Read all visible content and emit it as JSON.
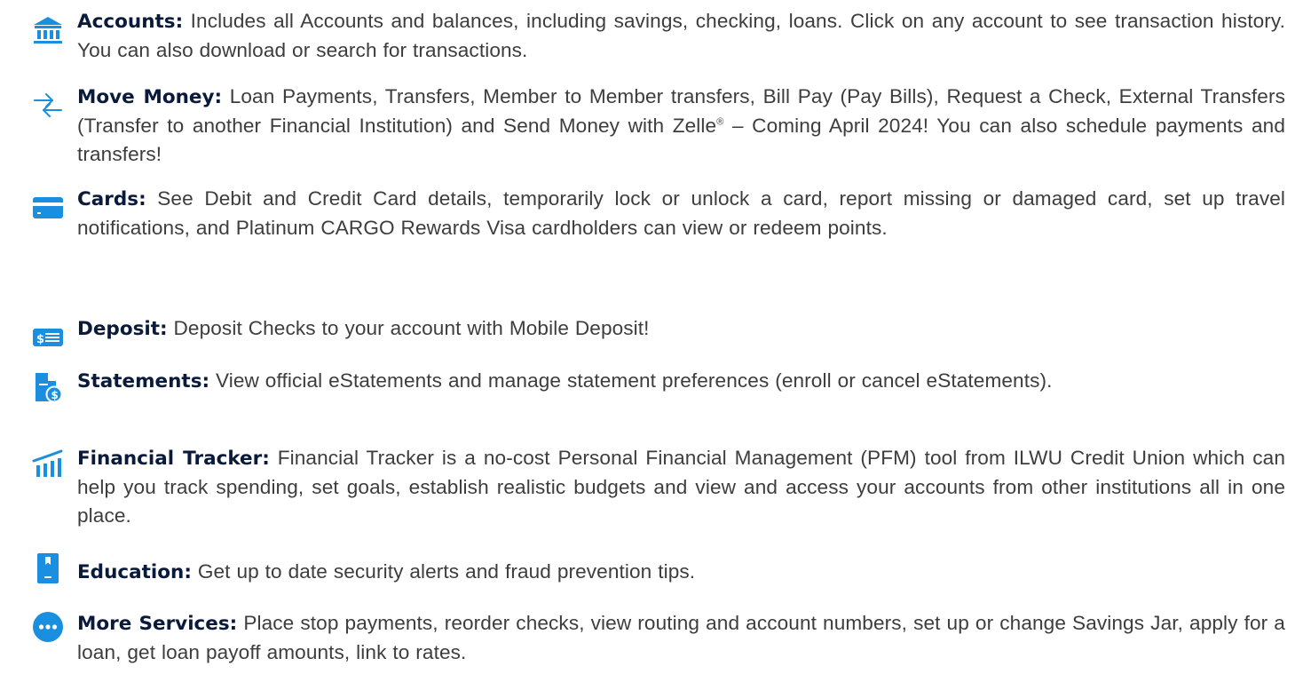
{
  "accent_color": "#1a8fe0",
  "label_color": "#0a1a3a",
  "text_color": "#3d3d3d",
  "items": [
    {
      "icon": "bank-icon",
      "label": "Accounts:",
      "text": " Includes all Accounts and balances, including savings, checking, loans. Click on any account to see transaction history. You can also download or search for transactions."
    },
    {
      "icon": "transfer-arrows-icon",
      "label": "Move Money:",
      "text": " Loan Payments, Transfers, Member to Member transfers, Bill Pay (Pay Bills), Request a Check, External Transfers (Transfer to another Financial Institution) and Send Money with Zelle",
      "sup": "®",
      "text_after": " – Coming April 2024! You can also schedule payments and transfers!"
    },
    {
      "icon": "credit-card-icon",
      "label": "Cards:",
      "text": " See Debit and Credit Card details, temporarily lock or unlock a card, report missing or damaged card, set up travel notifications, and Platinum CARGO Rewards Visa cardholders can view or redeem points."
    },
    {
      "icon": "check-deposit-icon",
      "label": "Deposit:",
      "text": " Deposit Checks to your account with Mobile Deposit!"
    },
    {
      "icon": "statement-document-icon",
      "label": "Statements:",
      "text": " View official eStatements and manage statement preferences (enroll or cancel eStatements)."
    },
    {
      "icon": "financial-tracker-icon",
      "label": "Financial Tracker:",
      "text": " Financial Tracker is a no-cost Personal Financial Management (PFM) tool from ILWU Credit Union which can help you track spending, set goals, establish realistic budgets and view and access your accounts from other institutions all in one place."
    },
    {
      "icon": "education-book-icon",
      "label": "Education:",
      "text": " Get up to date security alerts and fraud prevention tips."
    },
    {
      "icon": "more-services-icon",
      "label": "More Services:",
      "text": " Place stop payments, reorder checks, view routing and account numbers, set up or change Savings Jar, apply for a loan, get loan payoff amounts, link to rates."
    }
  ]
}
